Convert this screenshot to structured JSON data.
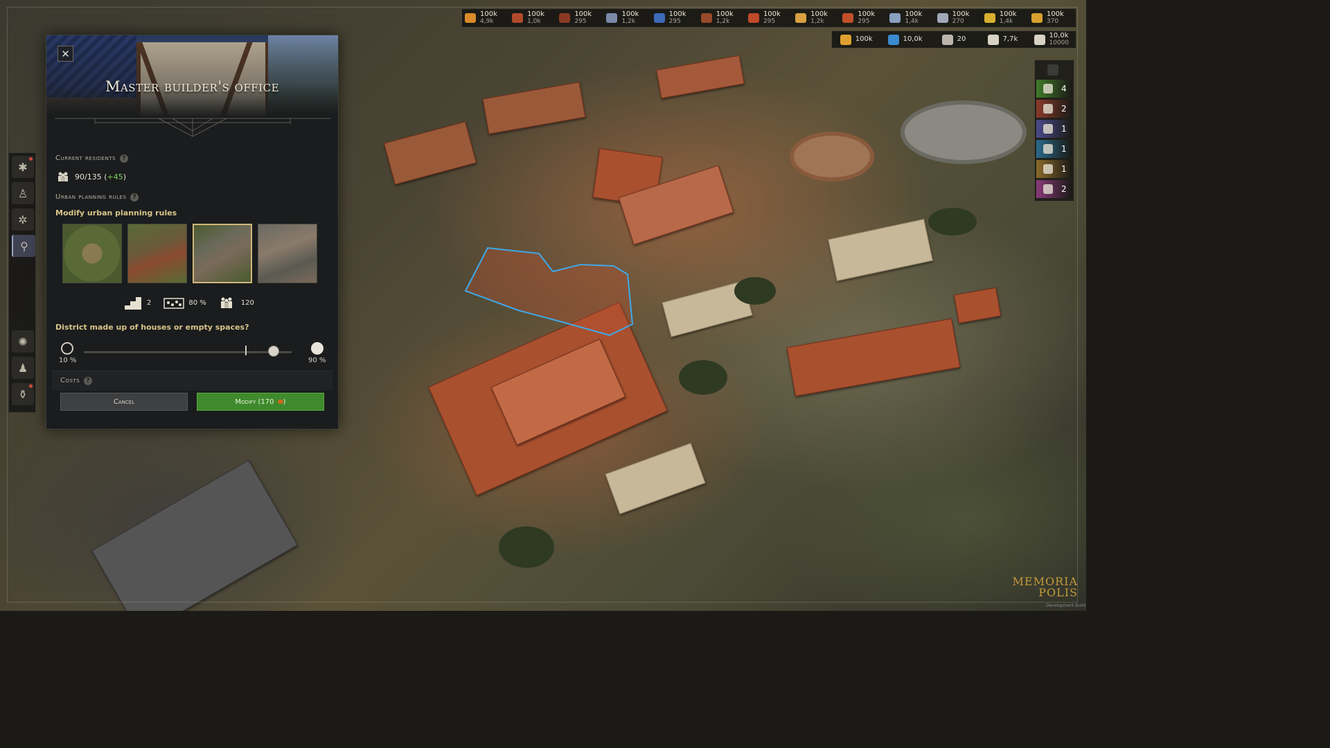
{
  "resources": [
    {
      "icon": "bread-icon",
      "value": "100k",
      "sub": "4,9k",
      "color": "#d98a2a"
    },
    {
      "icon": "meat-icon",
      "value": "100k",
      "sub": "1,0k",
      "color": "#b04a2a"
    },
    {
      "icon": "log-icon",
      "value": "100k",
      "sub": "295",
      "color": "#8a3a22"
    },
    {
      "icon": "tool-icon",
      "value": "100k",
      "sub": "1,2k",
      "color": "#7a8aa8"
    },
    {
      "icon": "cloth-icon",
      "value": "100k",
      "sub": "295",
      "color": "#3e6ab8"
    },
    {
      "icon": "leather-icon",
      "value": "100k",
      "sub": "1,2k",
      "color": "#9a4a2a"
    },
    {
      "icon": "brick-icon",
      "value": "100k",
      "sub": "295",
      "color": "#c04a2a"
    },
    {
      "icon": "wheat-icon",
      "value": "100k",
      "sub": "1,2k",
      "color": "#d8a040"
    },
    {
      "icon": "torch-icon",
      "value": "100k",
      "sub": "295",
      "color": "#c0502a"
    },
    {
      "icon": "fish-icon",
      "value": "100k",
      "sub": "1,4k",
      "color": "#8aa0c0"
    },
    {
      "icon": "sword-icon",
      "value": "100k",
      "sub": "270",
      "color": "#a0a8b8"
    },
    {
      "icon": "gold-icon",
      "value": "100k",
      "sub": "1,4k",
      "color": "#d8b030"
    },
    {
      "icon": "coin-icon",
      "value": "100k",
      "sub": "370",
      "color": "#d8a030"
    }
  ],
  "resources2": [
    {
      "icon": "money-icon",
      "value": "100k",
      "sub": "",
      "color": "#e0a030"
    },
    {
      "icon": "knowledge-icon",
      "value": "10,0k",
      "sub": "",
      "color": "#3a8ad0"
    },
    {
      "icon": "scroll-icon",
      "value": "20",
      "sub": "",
      "color": "#bcb6aa"
    },
    {
      "icon": "citizens-icon",
      "value": "7,7k",
      "sub": "",
      "color": "#d8d2c4"
    },
    {
      "icon": "population-icon",
      "value": "10,0k",
      "sub": "10000",
      "color": "#d8d2c4"
    }
  ],
  "right_panel": [
    {
      "icon": "farmer-icon",
      "count": "4",
      "color": "#3f7a2a"
    },
    {
      "icon": "merchant-icon",
      "count": "2",
      "color": "#8a3a2a"
    },
    {
      "icon": "bishop-icon",
      "count": "1",
      "color": "#4a4a8a"
    },
    {
      "icon": "scholar-icon",
      "count": "1",
      "color": "#2a6a8a"
    },
    {
      "icon": "artisan-icon",
      "count": "1",
      "color": "#8a6a2a"
    },
    {
      "icon": "noble-icon",
      "count": "2",
      "color": "#8a3a7a"
    }
  ],
  "toolbar": [
    {
      "icon": "farmer-tool-icon",
      "glyph": "✱",
      "alert": true,
      "active": false
    },
    {
      "icon": "worker-tool-icon",
      "glyph": "♙",
      "alert": false,
      "active": false
    },
    {
      "icon": "craft-tool-icon",
      "glyph": "✲",
      "alert": false,
      "active": false
    },
    {
      "icon": "religion-tool-icon",
      "glyph": "⚲",
      "alert": false,
      "active": true
    },
    {
      "icon": "settings-tool-icon",
      "glyph": "✺",
      "alert": false,
      "active": false
    },
    {
      "icon": "people-tool-icon",
      "glyph": "♟",
      "alert": false,
      "active": false
    },
    {
      "icon": "potion-tool-icon",
      "glyph": "⚱",
      "alert": true,
      "active": false
    }
  ],
  "panel": {
    "title": "Master builder's office",
    "close": "✕",
    "residents_header": "Current residents",
    "residents": "90/135 (",
    "residents_plus": "+45",
    "residents_close": ")",
    "rules_header": "Urban planning rules",
    "modify_rules": "Modify urban planning rules",
    "stat_floors": "2",
    "stat_density": "80 %",
    "stat_residents": "120",
    "question": "District made up of houses or empty spaces?",
    "slider_min": "10 %",
    "slider_max": "90 %",
    "slider_value": 0.93,
    "costs_header": "Costs",
    "cancel": "Cancel",
    "modify": "Modify (170 ",
    "modify_close": ")",
    "help": "?"
  },
  "logo": {
    "line1": "MEMORIA",
    "line2": "POLIS"
  },
  "dev_build": "Development Build"
}
